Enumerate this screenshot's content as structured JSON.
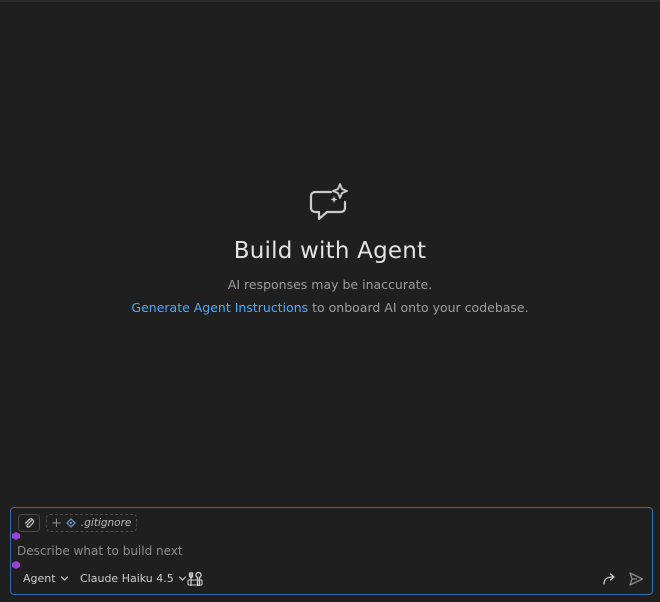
{
  "welcome": {
    "icon": "chat-sparkle-icon",
    "title": "Build with Agent",
    "disclaimer": "AI responses may be inaccurate.",
    "link_text": "Generate Agent Instructions",
    "link_suffix": " to onboard AI onto your codebase."
  },
  "chat_input": {
    "placeholder": "Describe what to build next",
    "value": "",
    "context_file": ".gitignore",
    "mode": "Agent",
    "model": "Claude Haiku 4.5"
  },
  "colors": {
    "background": "#1f1f1f",
    "accent_link": "#4daafc",
    "input_border": "#2f6fae",
    "marker": "#9b3fd6"
  }
}
